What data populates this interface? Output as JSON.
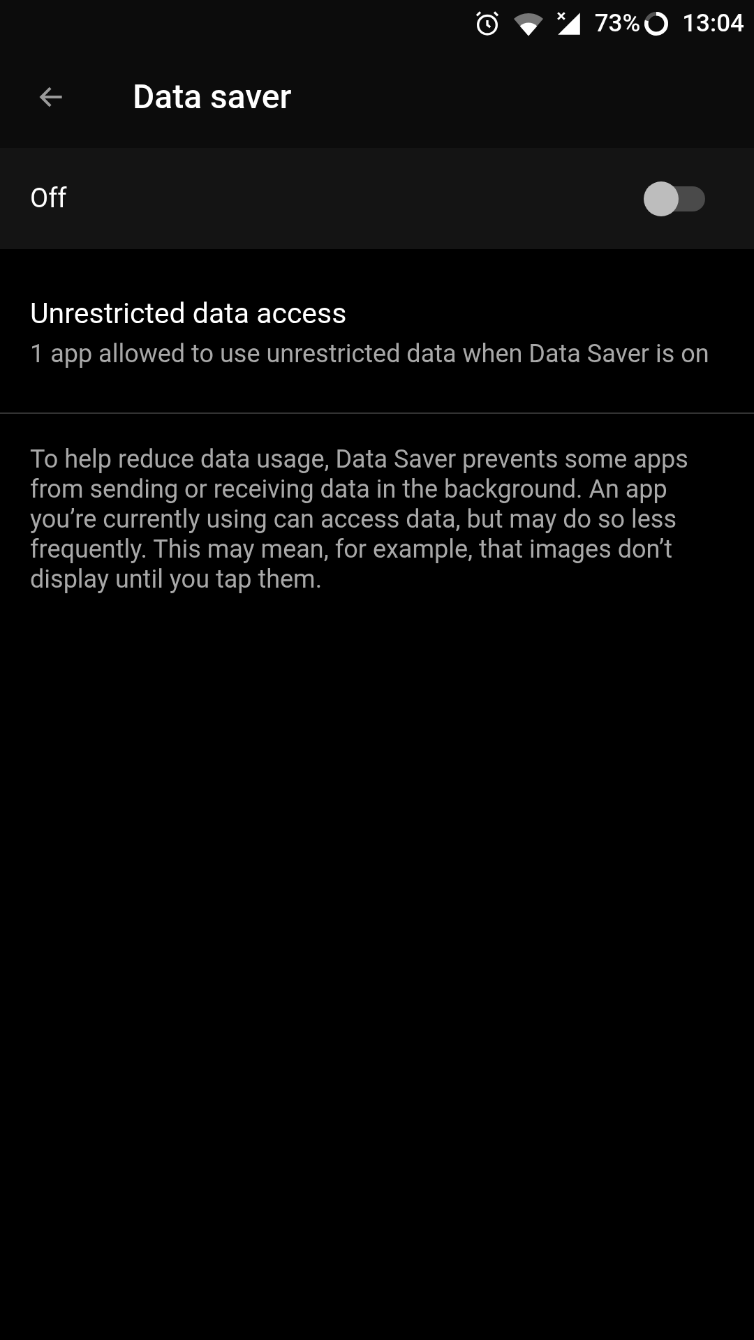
{
  "status_bar": {
    "battery": "73%",
    "time": "13:04"
  },
  "toolbar": {
    "title": "Data saver"
  },
  "master_switch": {
    "label": "Off",
    "on": false
  },
  "items": [
    {
      "title": "Unrestricted data access",
      "summary": "1 app allowed to use unrestricted data when Data Saver is on"
    }
  ],
  "footer": "To help reduce data usage, Data Saver prevents some apps from sending or receiving data in the background. An app you’re currently using can access data, but may do so less frequently. This may mean, for example, that images don’t display until you tap them."
}
